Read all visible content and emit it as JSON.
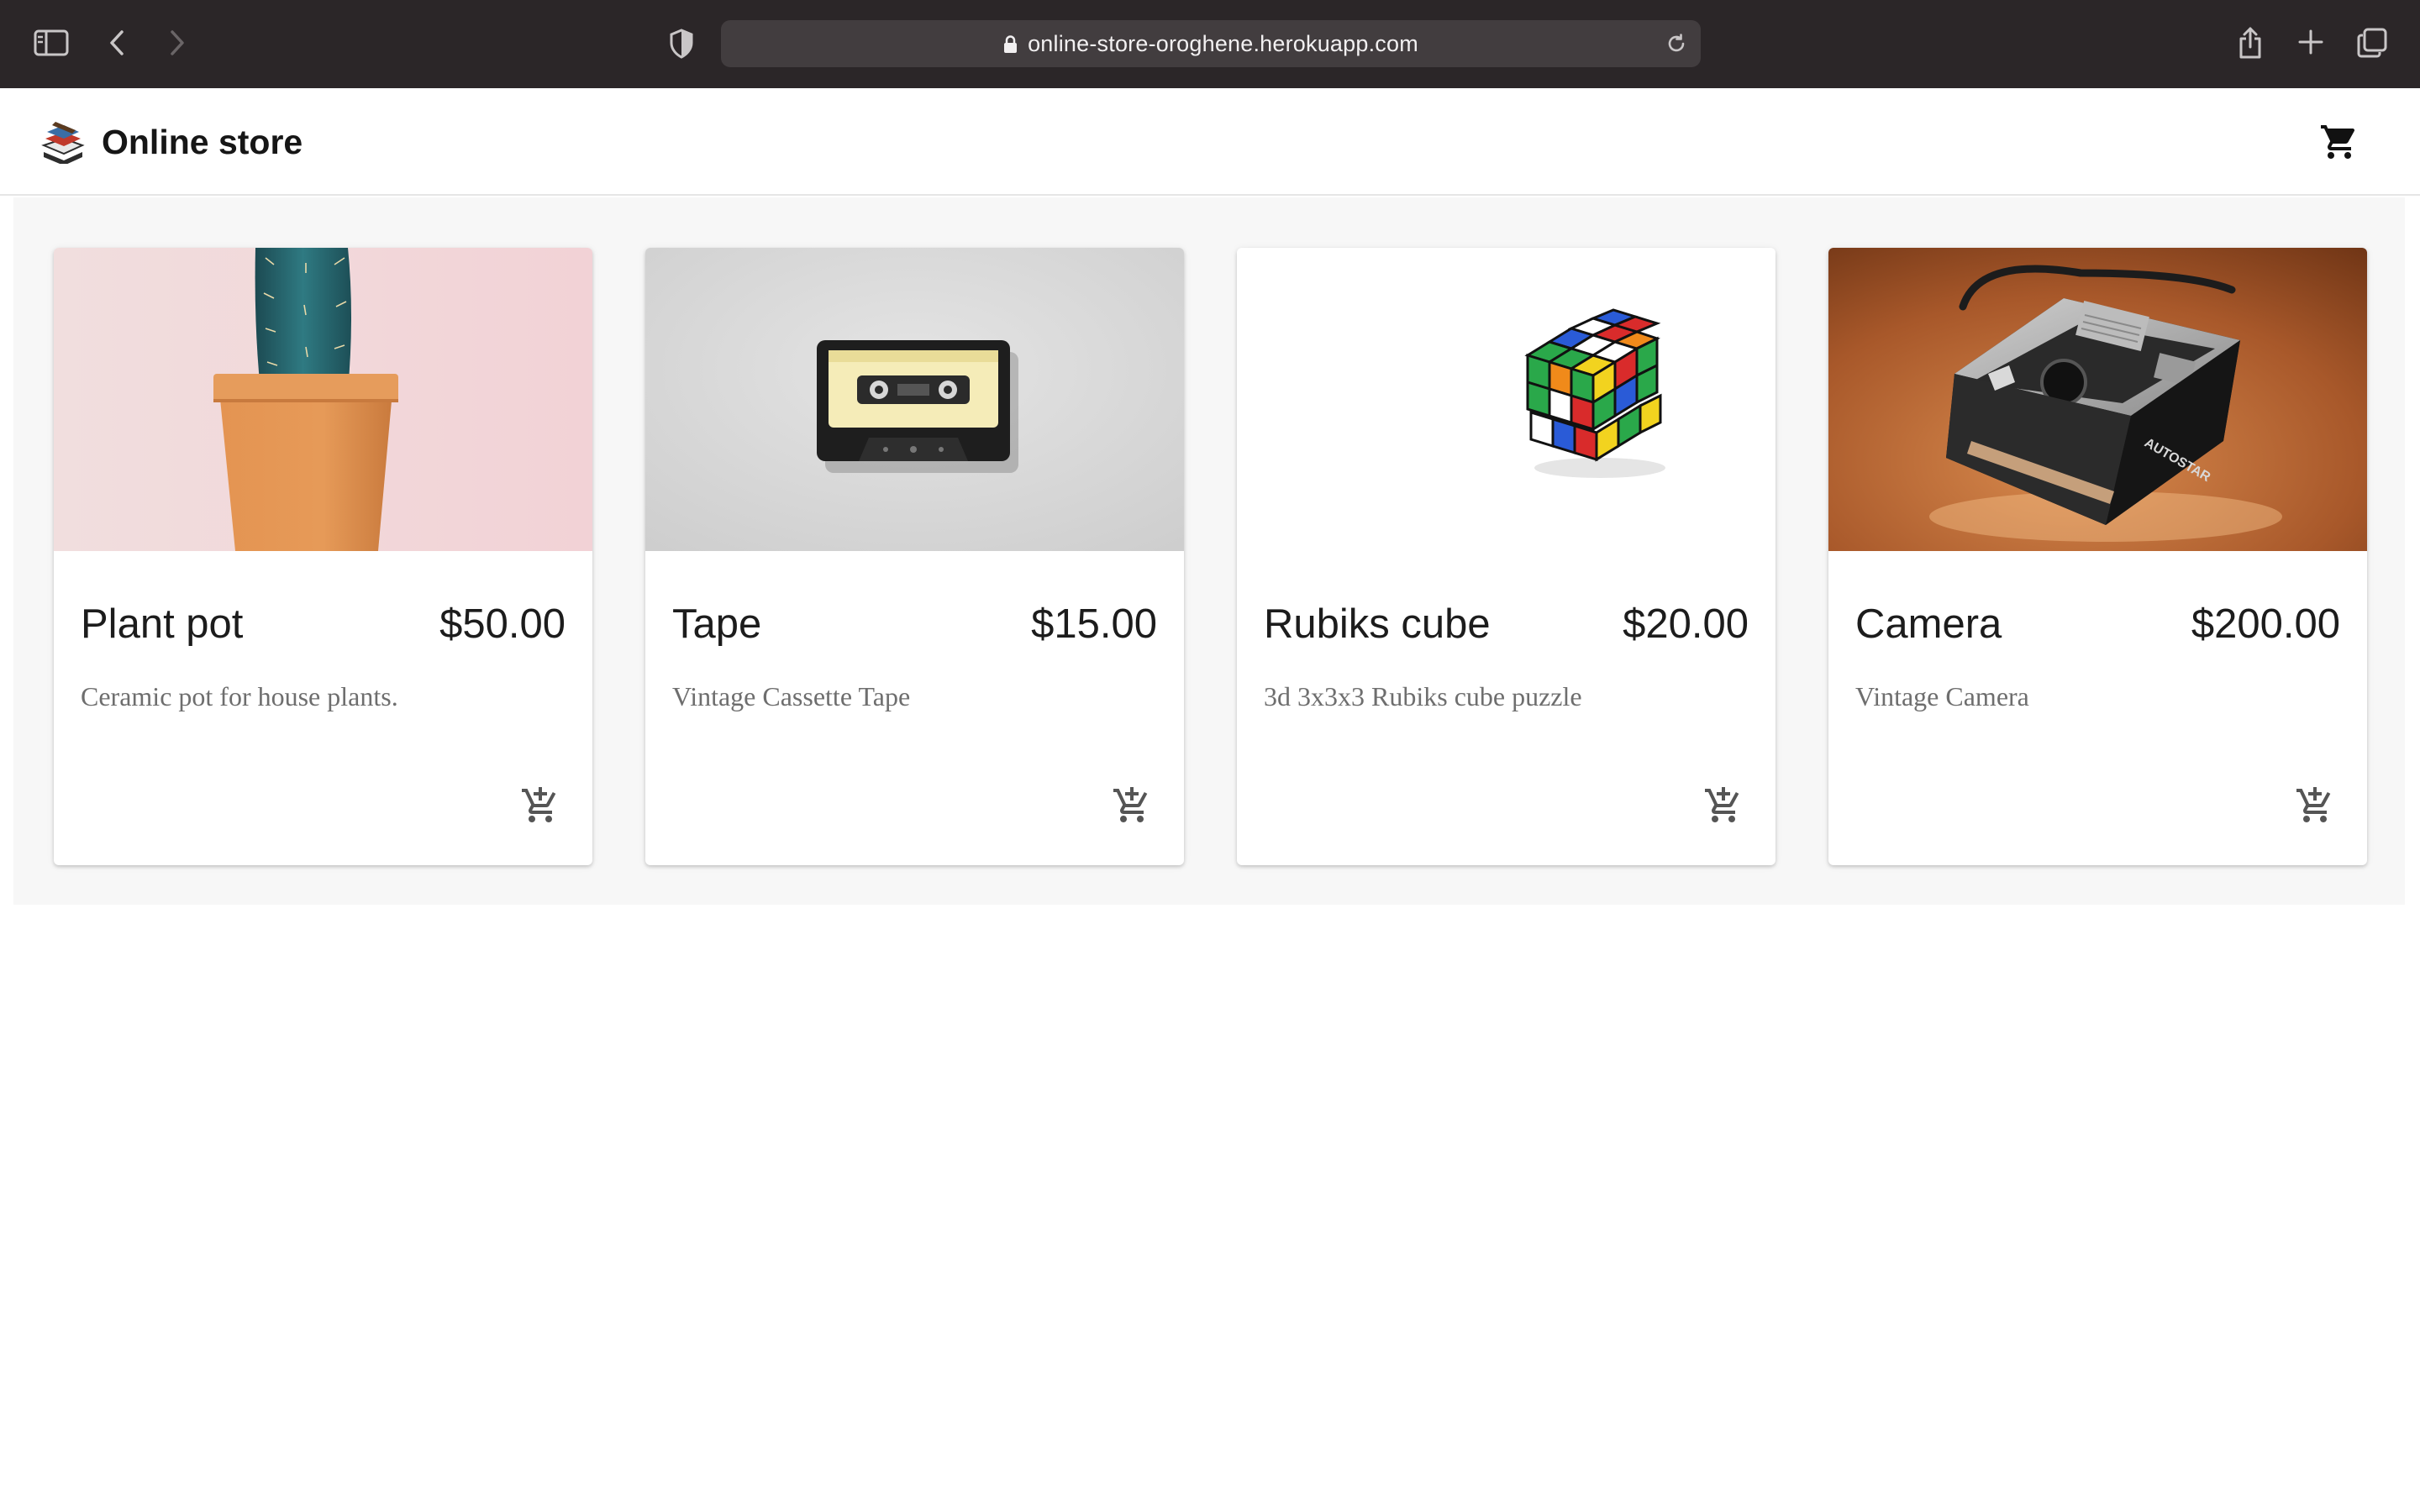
{
  "browser": {
    "url": "online-store-oroghene.herokuapp.com",
    "icons": [
      "sidebar-icon",
      "back-icon",
      "forward-icon",
      "privacy-shield-icon",
      "lock-icon",
      "reload-icon",
      "share-icon",
      "new-tab-icon",
      "tabs-overview-icon"
    ]
  },
  "header": {
    "title": "Online store",
    "logo_icon": "books-logo-icon",
    "cart_icon": "shopping-cart-icon"
  },
  "products": [
    {
      "name": "Plant pot",
      "price": "$50.00",
      "description": "Ceramic pot for house plants.",
      "image": "cactus-in-terracotta-pot",
      "action_icon": "add-shopping-cart-icon"
    },
    {
      "name": "Tape",
      "price": "$15.00",
      "description": "Vintage Cassette Tape",
      "image": "cassette-tape",
      "action_icon": "add-shopping-cart-icon"
    },
    {
      "name": "Rubiks cube",
      "price": "$20.00",
      "description": "3d 3x3x3 Rubiks cube puzzle",
      "image": "rubiks-cube",
      "action_icon": "add-shopping-cart-icon"
    },
    {
      "name": "Camera",
      "price": "$200.00",
      "description": "Vintage Camera",
      "image": "vintage-camera",
      "action_icon": "add-shopping-cart-icon"
    }
  ],
  "colors": {
    "browser_bar": "#2b2628",
    "url_field": "#423d3f",
    "page_background": "#f7f7f7",
    "card_background": "#ffffff",
    "text_primary": "#1c1c1c",
    "text_secondary": "#6e6e6e"
  }
}
